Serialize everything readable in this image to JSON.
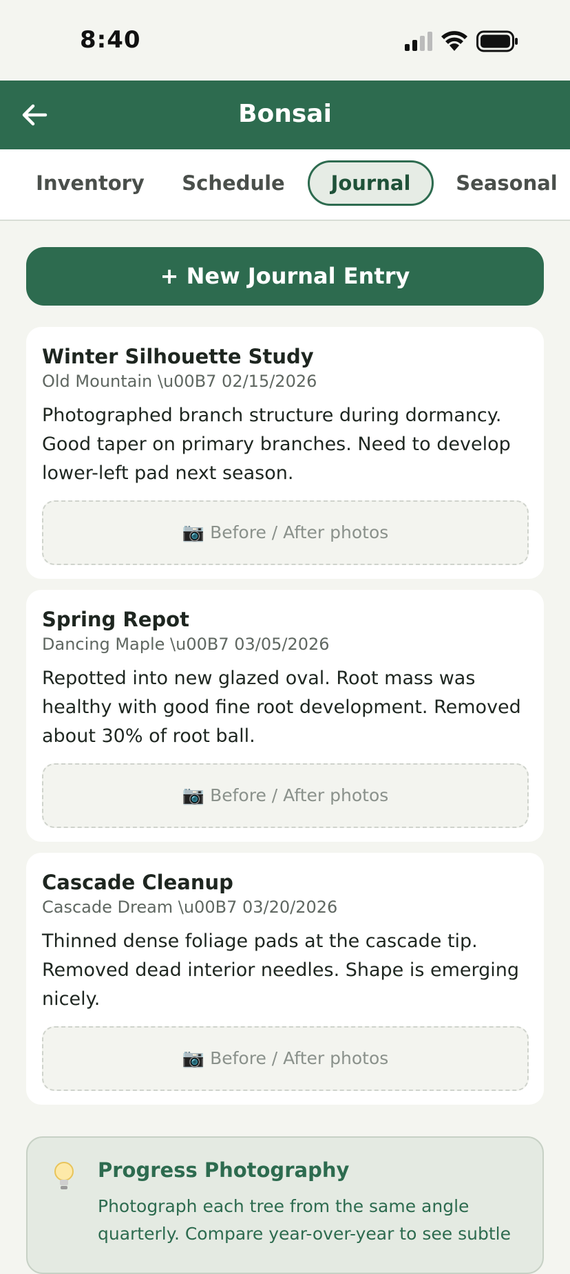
{
  "status_bar": {
    "time": "8:40"
  },
  "header": {
    "title": "Bonsai",
    "back_icon": "arrow-left-icon"
  },
  "tabs": [
    {
      "label": "Inventory",
      "active": false
    },
    {
      "label": "Schedule",
      "active": false
    },
    {
      "label": "Journal",
      "active": true
    },
    {
      "label": "Seasonal",
      "active": false
    }
  ],
  "new_entry": {
    "label": "+ New Journal Entry"
  },
  "entries": [
    {
      "title": "Winter Silhouette Study",
      "meta": "Old Mountain \\u00B7 02/15/2026",
      "body": "Photographed branch structure during dormancy. Good taper on primary branches. Need to develop lower-left pad next season.",
      "photos_label": "Before / After photos"
    },
    {
      "title": "Spring Repot",
      "meta": "Dancing Maple \\u00B7 03/05/2026",
      "body": "Repotted into new glazed oval. Root mass was healthy with good fine root development. Removed about 30% of root ball.",
      "photos_label": "Before / After photos"
    },
    {
      "title": "Cascade Cleanup",
      "meta": "Cascade Dream \\u00B7 03/20/2026",
      "body": "Thinned dense foliage pads at the cascade tip. Removed dead interior needles. Shape is emerging nicely.",
      "photos_label": "Before / After photos"
    }
  ],
  "tip": {
    "icon": "lightbulb-icon",
    "title": "Progress Photography",
    "body": "Photograph each tree from the same angle quarterly. Compare year-over-year to see subtle"
  },
  "colors": {
    "brand": "#2d6b4f",
    "background": "#f4f5f0"
  }
}
